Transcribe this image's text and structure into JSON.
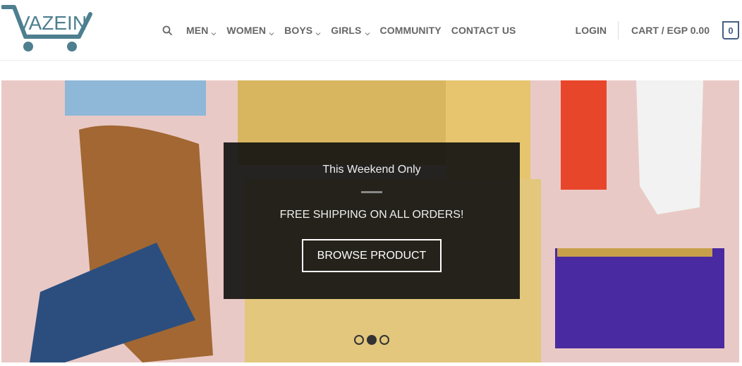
{
  "brand": {
    "logo_text": "VAZEIN",
    "color": "#4d7f8f"
  },
  "nav": {
    "items": [
      {
        "label": "MEN",
        "has_dropdown": true
      },
      {
        "label": "WOMEN",
        "has_dropdown": true
      },
      {
        "label": "BOYS",
        "has_dropdown": true
      },
      {
        "label": "GIRLS",
        "has_dropdown": true
      },
      {
        "label": "COMMUNITY",
        "has_dropdown": false
      },
      {
        "label": "CONTACT US",
        "has_dropdown": false
      }
    ]
  },
  "account": {
    "login_label": "LOGIN"
  },
  "cart": {
    "label": "CART / EGP 0.00",
    "count": "0"
  },
  "hero": {
    "eyebrow": "This Weekend Only",
    "headline": "FREE SHIPPING ON ALL ORDERS!",
    "button_label": "BROWSE PRODUCT",
    "slides_total": 3,
    "active_slide": 2
  },
  "colors": {
    "accent": "#446084",
    "nav_text": "#666666"
  }
}
